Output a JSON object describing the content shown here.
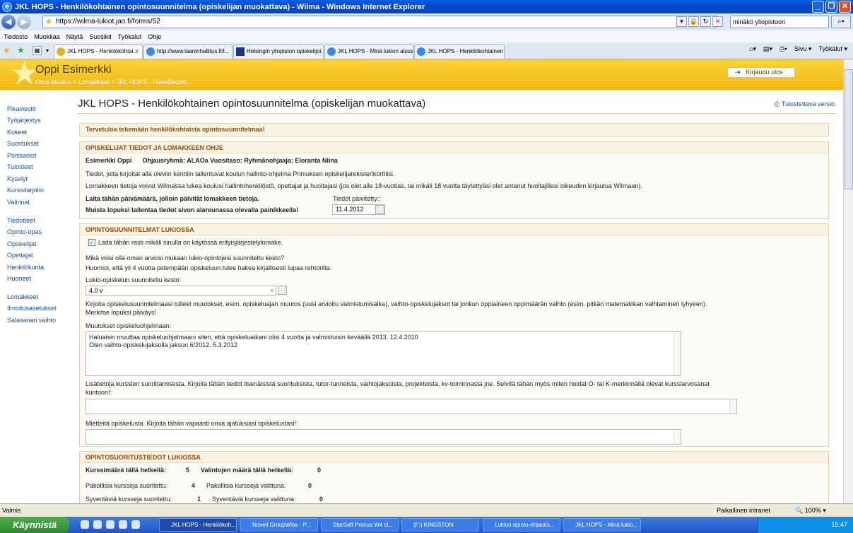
{
  "window": {
    "title": "JKL HOPS - Henkilökohtainen opintosuunnitelma (opiskelijan muokattava) - Wilma - Windows Internet Explorer",
    "url": "https://wilma-lukiot.jao.fi/forms/52",
    "search_text": "minäkö yliopistoon"
  },
  "menu": [
    "Tiedosto",
    "Muokkaa",
    "Näytä",
    "Suosikit",
    "Työkalut",
    "Ohje"
  ],
  "tabs": [
    {
      "label": "JKL HOPS - Henkilökohtai...",
      "active": true
    },
    {
      "label": "http://www.laaninhallitus.fi/l...",
      "active": false
    },
    {
      "label": "Helsingin yliopiston opiskelijoi...",
      "active": false
    },
    {
      "label": "JKL HOPS - Minä lukion aluss...",
      "active": false
    },
    {
      "label": "JKL HOPS - Henkilökohtainen ...",
      "active": false
    }
  ],
  "toolbar_right": [
    "Sivu ▾",
    "Työkalut ▾"
  ],
  "header": {
    "user_name": "Oppi Esimerkki",
    "breadcrumb": "Oma etusivu > Lomakkeet > JKL HOPS - Henkilökoht...",
    "logout": "Kirjaudu ulos"
  },
  "sidebar": {
    "group1": [
      "Pikaviestit",
      "Työjärjestys",
      "Kokeet",
      "Suoritukset",
      "Poissaolot",
      "Tulosteet",
      "Kyselyt",
      "Kurssitarjotin",
      "Valinnat"
    ],
    "group2": [
      "Tiedotteet",
      "Opinto-opas",
      "Opiskelijat",
      "Opettajat",
      "Henkilökunta",
      "Huoneet"
    ],
    "group3": [
      "Lomakkeet",
      "Ilmoitusasetukset",
      "Salasanan vaihto"
    ]
  },
  "page": {
    "title": "JKL HOPS - Henkilökohtainen opintosuunnitelma (opiskelijan muokattava)",
    "print_link": "Tulostettava versio",
    "welcome": "Tervetuloa tekemään henkilökohtaista opintosuunnitelmaa!"
  },
  "section1": {
    "heading": "OPISKELIJAT TIEDOT JA LOMAKKEEN OHJE",
    "student_line": "Esimerkki Oppi      Ohjausryhmä: ALAOa Vuositaso: Ryhmänohjaaja: Eloranta Niina",
    "info1": "Tiedot, joita kirjoitat alla oleviin kenttiin tallentuvat koulun hallinto-ohjelma Primuksen opiskelijarekisterikorttiisi.",
    "info2": "Lomakkeen tietoja voivat Wilmassa lukea koulusi hallintohenkilöstö, opettajat ja huoltajasi (jos olet alle 18-vuotias, tai mikäli 18 vuotta täytettyäsi olet antanut huoltajillesi oikeuden kirjautua Wilmaan).",
    "date_instr": "Laita tähän päivämäärä, jolloin päivität lomakkeen tietoja.",
    "save_instr": "Muista lopuksi tallentaa tiedot sivun alareunassa olevalla painikkeella!",
    "date_label": "Tiedot päivitetty::",
    "date_value": "11.4.2012"
  },
  "section2": {
    "heading": "OPINTOSUUNNITELMAT LUKIOSSA",
    "checkbox_label": "Laita tähän rasti mikäli sinulla on käytössä erityisjärjestelylomake.",
    "checkbox_checked": true,
    "q_duration": "Mikä voisi olla oman arviosi mukaan lukio-opintojesi suunniteltu kesto?",
    "note_duration": "Huomioi, että yli 4 vuotta pidempään opiskeluun tulee hakea kirjallisesti lupaa rehtorilta.",
    "duration_label": "Lukio-opiskelun suunniteltu kesto:",
    "duration_value": "4.0 v",
    "changes_instr": "Kirjoita opiskelusuunnitelmaasi tulleet muutokset, esim. opiskeluajan muutos (uusi arvioitu valmistumisaika), vaihto-opiskelujaksot tai jonkun oppiaineen oppimäärän vaihto (esim. pitkän matematiikan vaihtaminen lyhyeen).",
    "changes_instr2": "Merkitse lopuksi päiväys!",
    "changes_label": "Muutokset opiskeluohjelmaan:",
    "changes_value": "Haluaisin muuttaa opiskeluohjelmaani siten, että opiskeluaikani olisi 4 vuotta ja valmistuisin keväällä 2013. 12.4.2010\nOlen vaihto-opiskelujaksolla jakson 6/2012. 5.3.2012",
    "extra_label": "Lisätietoja kurssien suorittamisesta. Kirjoita tähän tiedot itsenäisistä suorituksista, tutor-tunneista, vaihtojaksoista, projekteista, kv-toiminnasta jne. Selvitä tähän myös miten hoidat O- tai K-merkinnällä olevat kurssiarvosanat",
    "extra_label2": "kuntoon!:",
    "thoughts_label": "Mietteitä opiskelusta. Kirjoita tähän vapaasti omia ajatuksiasi opiskelustasi!:"
  },
  "section3": {
    "heading": "OPINTOSUORITUSTIEDOT LUKIOSSA",
    "courses_label": "Kurssimäärä tällä hetkellä:",
    "courses_value": "5",
    "choices_label": "Valintojen määrä tällä hetkellä:",
    "choices_value": "0",
    "mand_done_label": "Pakollisia kursseja suoritettu:",
    "mand_done_value": "4",
    "mand_sel_label": "Pakollisia kursseja valittuna:",
    "mand_sel_value": "0",
    "deep_done_label": "Syventäviä kursseja suoritettu:",
    "deep_done_value": "1",
    "deep_sel_label": "Syventäviä kursseja valittuna:",
    "deep_sel_value": "0"
  },
  "status": {
    "left": "Valmis",
    "zone": "Paikallinen intranet",
    "zoom": "100%"
  },
  "taskbar": {
    "start": "Käynnistä",
    "tasks": [
      {
        "label": "JKL HOPS - Henkilökoh...",
        "active": true
      },
      {
        "label": "Novell GroupWise - P...",
        "active": false
      },
      {
        "label": "StarSoft Primus W4 cl...",
        "active": false
      },
      {
        "label": "(F:) KINGSTON",
        "active": false
      },
      {
        "label": "Lukion opinto-ohjauks...",
        "active": false
      },
      {
        "label": "JKL HOPS - Minä lukio...",
        "active": false
      }
    ],
    "clock": "15:47"
  },
  "colors": {
    "header": "#f3b715",
    "link": "#1a4e9a",
    "section_heading": "#a04b0a"
  }
}
